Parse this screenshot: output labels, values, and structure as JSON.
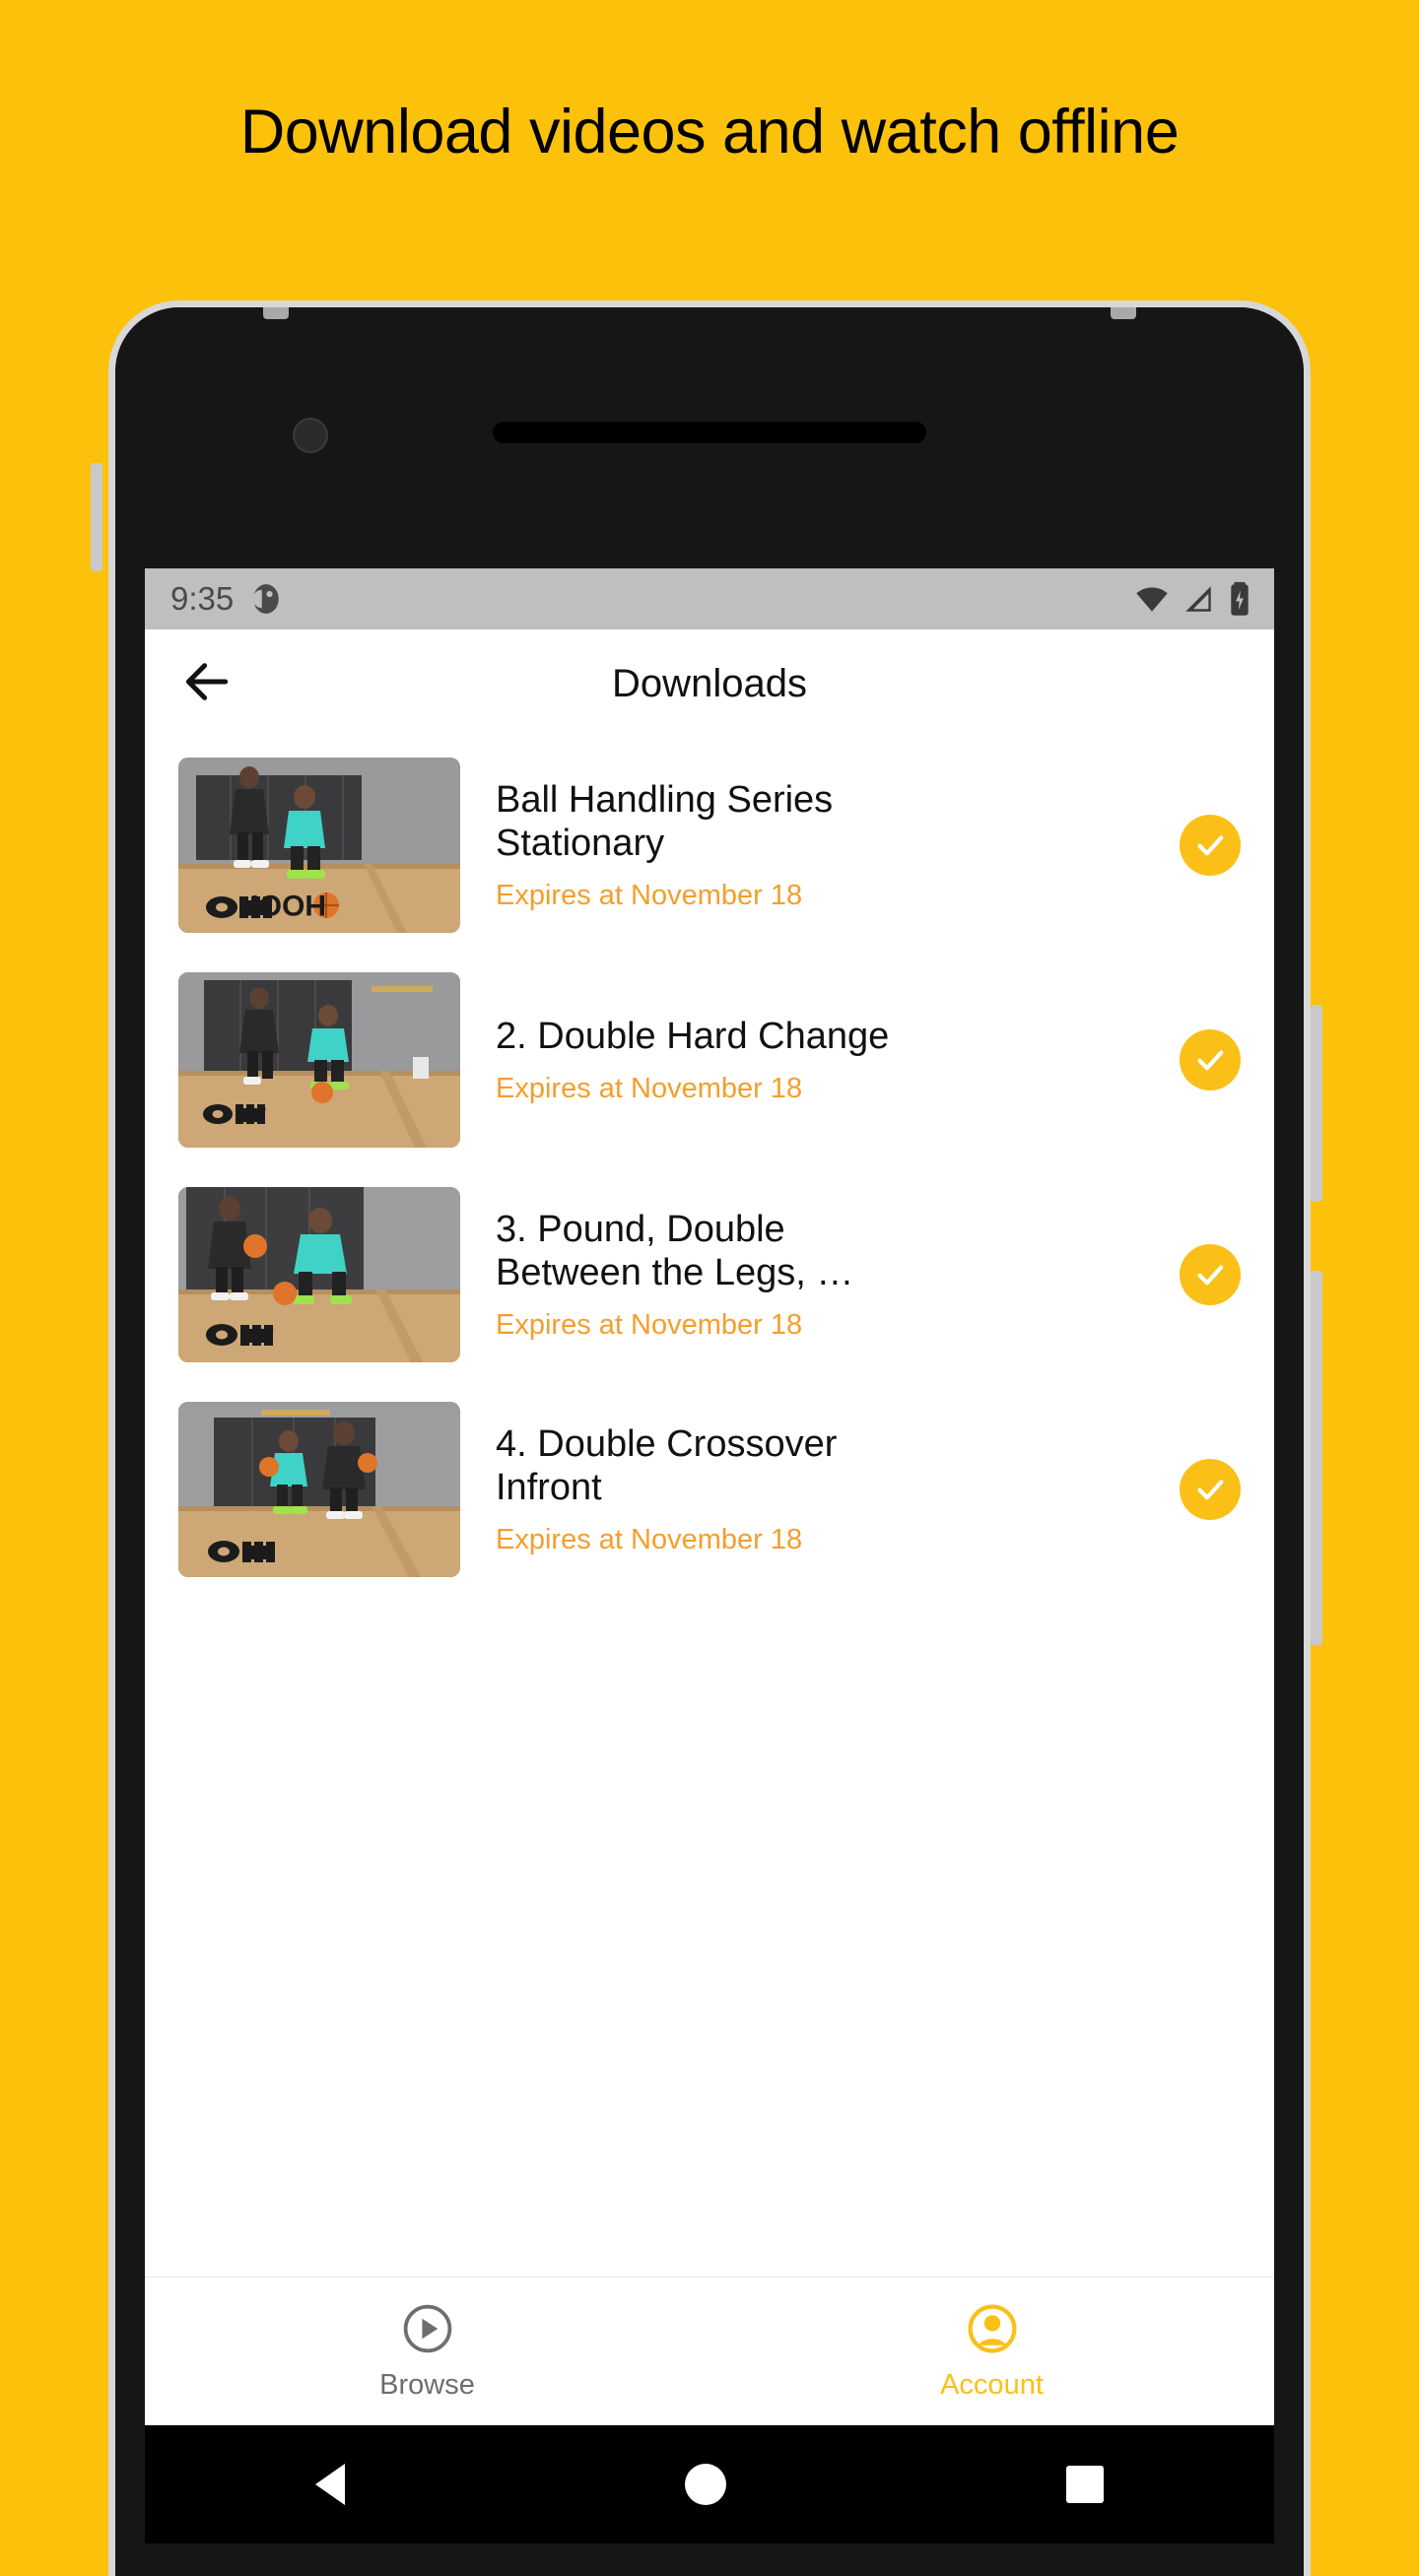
{
  "promo": {
    "headline": "Download videos and watch offline",
    "background_color": "#FCC10B"
  },
  "colors": {
    "brand_yellow": "#FAC017",
    "expires_orange": "#F59E2C",
    "nav_inactive_grey": "#6E6E6E",
    "status_bar_grey": "#BFBFBF"
  },
  "status_bar": {
    "time": "9:35",
    "notification_icon": "clock-notification-icon",
    "icons": [
      "wifi-icon",
      "cellular-signal-icon",
      "battery-icon"
    ]
  },
  "app_bar": {
    "back_icon": "arrow-left-icon",
    "title": "Downloads"
  },
  "downloads": {
    "items": [
      {
        "title": "Ball Handling Series\nStationary",
        "expires": "Expires at November 18",
        "status_icon": "check-circle-icon",
        "thumbnail": "basketball-drill-thumbnail"
      },
      {
        "title": "2. Double Hard Change",
        "expires": "Expires at November 18",
        "status_icon": "check-circle-icon",
        "thumbnail": "basketball-drill-thumbnail"
      },
      {
        "title": "3. Pound, Double\nBetween the Legs, …",
        "expires": "Expires at November 18",
        "status_icon": "check-circle-icon",
        "thumbnail": "basketball-drill-thumbnail"
      },
      {
        "title": "4. Double Crossover\nInfront",
        "expires": "Expires at November 18",
        "status_icon": "check-circle-icon",
        "thumbnail": "basketball-drill-thumbnail"
      }
    ]
  },
  "bottom_nav": {
    "items": [
      {
        "label": "Browse",
        "icon": "play-circle-icon",
        "active": false
      },
      {
        "label": "Account",
        "icon": "account-circle-icon",
        "active": true
      }
    ]
  },
  "system_nav": {
    "back_icon": "triangle-back-icon",
    "home_icon": "circle-home-icon",
    "recents_icon": "square-recents-icon"
  }
}
